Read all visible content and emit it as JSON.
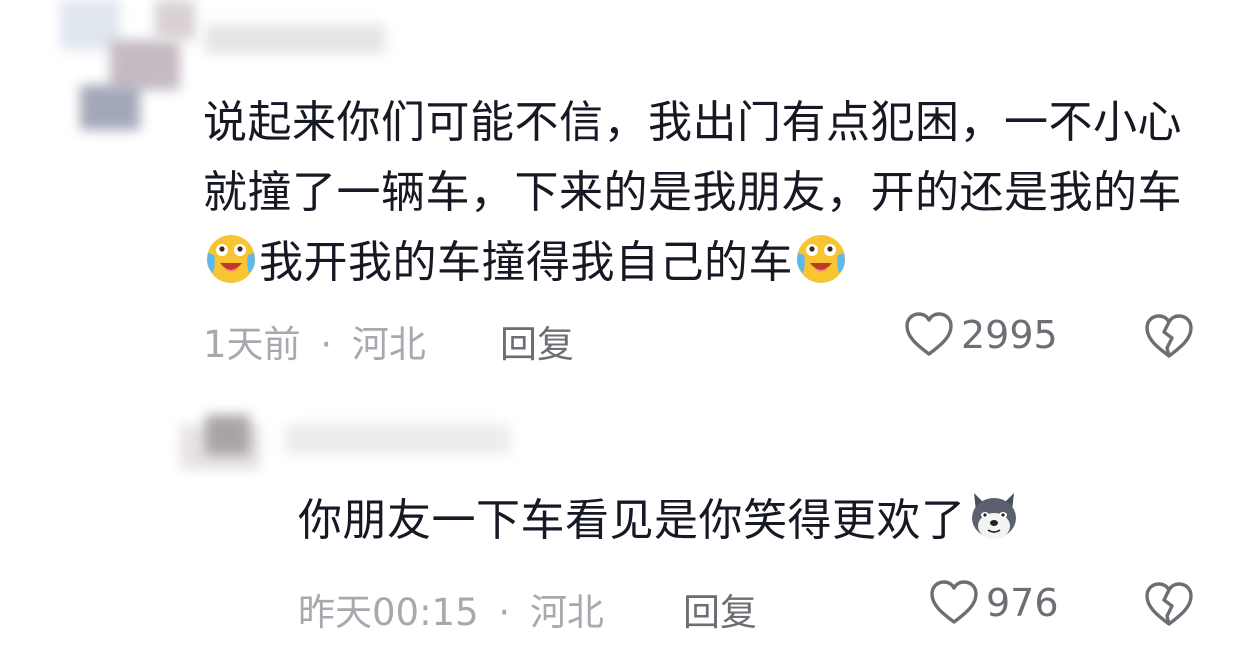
{
  "comments": [
    {
      "text_parts": [
        "说起来你们可能不信，我出门有点犯困，一不小心就撞了一辆车，下来的是我朋友，开的还是我的车",
        "我开我的车撞得我自己的车"
      ],
      "time": "1天前",
      "separator": "·",
      "location": "河北",
      "reply_label": "回复",
      "like_count": "2995",
      "emoji": "crying-laughing-emoji"
    },
    {
      "text": "你朋友一下车看见是你笑得更欢了",
      "time": "昨天00:15",
      "separator": "·",
      "location": "河北",
      "reply_label": "回复",
      "like_count": "976",
      "emoji": "husky-dog-emoji"
    }
  ],
  "colors": {
    "text": "#161823",
    "meta": "#a8a8ae",
    "action": "#6d6e73",
    "emoji_yellow": "#f7c531"
  }
}
